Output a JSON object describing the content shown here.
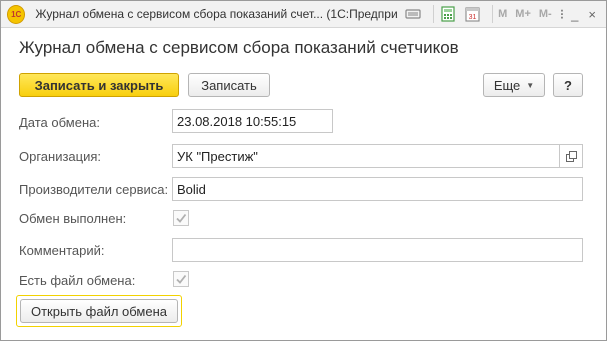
{
  "window": {
    "title": "Журнал обмена с сервисом сбора показаний счет...  (1С:Предприятие)",
    "app_logo_text": "1С",
    "mem_labels": [
      "M",
      "M+",
      "M-"
    ],
    "menu_glyph": "⁝",
    "minimize_glyph": "_",
    "close_glyph": "×"
  },
  "form": {
    "title": "Журнал обмена с сервисом сбора показаний счетчиков"
  },
  "commands": {
    "save_and_close": "Записать и закрыть",
    "save": "Записать",
    "more": "Еще",
    "help": "?"
  },
  "fields": {
    "exchange_date": {
      "label": "Дата обмена:",
      "value": "23.08.2018 10:55:15"
    },
    "organization": {
      "label": "Организация:",
      "value": "УК \"Престиж\""
    },
    "providers": {
      "label": "Производители сервиса:",
      "value": "Bolid"
    },
    "exchange_done": {
      "label": "Обмен выполнен:",
      "checked": true
    },
    "comment": {
      "label": "Комментарий:",
      "value": ""
    },
    "has_file": {
      "label": "Есть файл обмена:",
      "checked": true
    }
  },
  "actions": {
    "open_file": "Открыть файл обмена"
  },
  "colors": {
    "primary_button": "#f8cf0e",
    "focus_border": "#f2d200",
    "checkmark": "#b0b0b0"
  }
}
